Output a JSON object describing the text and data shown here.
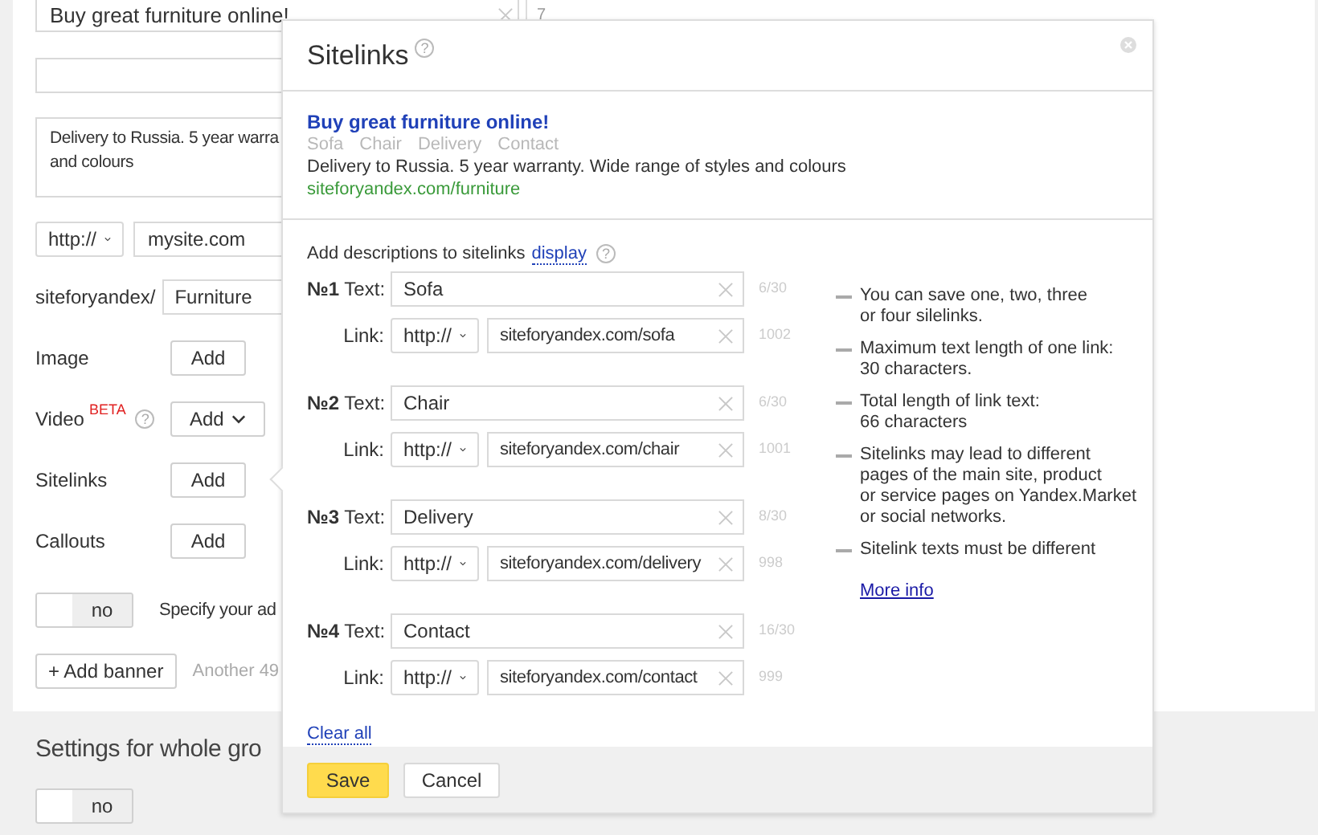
{
  "background": {
    "title_field": {
      "value": "Buy great furniture online!",
      "counter": "7"
    },
    "text_field": {
      "lines": [
        "Delivery to Russia. 5 year warra",
        "and colours"
      ]
    },
    "protocol": "http://",
    "domain": "mysite.com",
    "path_prefix": "siteforyandex/",
    "path": "Furniture",
    "extras": [
      {
        "kind": "plain",
        "label": "Image",
        "button": "Add"
      },
      {
        "kind": "dropdown",
        "label": "Video",
        "badge": "BETA",
        "help": "?",
        "button": "Add"
      },
      {
        "kind": "plain",
        "label": "Sitelinks",
        "button": "Add"
      },
      {
        "kind": "plain",
        "label": "Callouts",
        "button": "Add"
      }
    ],
    "toggle": {
      "on": false,
      "label": "no"
    },
    "toggle_caption": "Specify your ad",
    "add_banner": "+ Add banner",
    "banner_note": "Another 49",
    "group_settings": {
      "title": "Settings for whole gro",
      "toggle": {
        "on": false,
        "label": "no"
      }
    }
  },
  "popup": {
    "title": "Sitelinks",
    "help": "?",
    "preview": {
      "title": "Buy great furniture online!",
      "links": [
        "Sofa",
        "Chair",
        "Delivery",
        "Contact"
      ],
      "text": "Delivery to Russia. 5 year warranty. Wide range of styles and colours",
      "url": "siteforyandex.com/furniture"
    },
    "intro": "Add descriptions to sitelinks",
    "intro_link": "display",
    "intro_help": "?",
    "rows": [
      {
        "number": "№1",
        "text_label": "Text:",
        "text": "Sofa",
        "text_counter": "6/30",
        "link_label": "Link:",
        "protocol": "http://",
        "link": "siteforyandex.com/sofa",
        "link_counter": "1002"
      },
      {
        "number": "№2",
        "text_label": "Text:",
        "text": "Chair",
        "text_counter": "6/30",
        "link_label": "Link:",
        "protocol": "http://",
        "link": "siteforyandex.com/chair",
        "link_counter": "1001"
      },
      {
        "number": "№3",
        "text_label": "Text:",
        "text": "Delivery",
        "text_counter": "8/30",
        "link_label": "Link:",
        "protocol": "http://",
        "link": "siteforyandex.com/delivery",
        "link_counter": "998"
      },
      {
        "number": "№4",
        "text_label": "Text:",
        "text": "Contact",
        "text_counter": "16/30",
        "link_label": "Link:",
        "protocol": "http://",
        "link": "siteforyandex.com/contact",
        "link_counter": "999"
      }
    ],
    "notes": [
      [
        "You can save one, two, three",
        "or four silelinks."
      ],
      [
        "Maximum text length of one link:",
        "30 characters."
      ],
      [
        "Total length of link text:",
        "66 characters"
      ],
      [
        "Sitelinks may lead to different",
        "pages of the main site, product",
        "or service pages on Yandex.Market",
        "or social networks."
      ],
      [
        "Sitelink texts must be different"
      ]
    ],
    "more_info": "More info",
    "clear_all": "Clear all",
    "buttons": [
      {
        "kind": "primary",
        "label": "Save"
      },
      {
        "kind": "secondary",
        "label": "Cancel"
      }
    ]
  }
}
